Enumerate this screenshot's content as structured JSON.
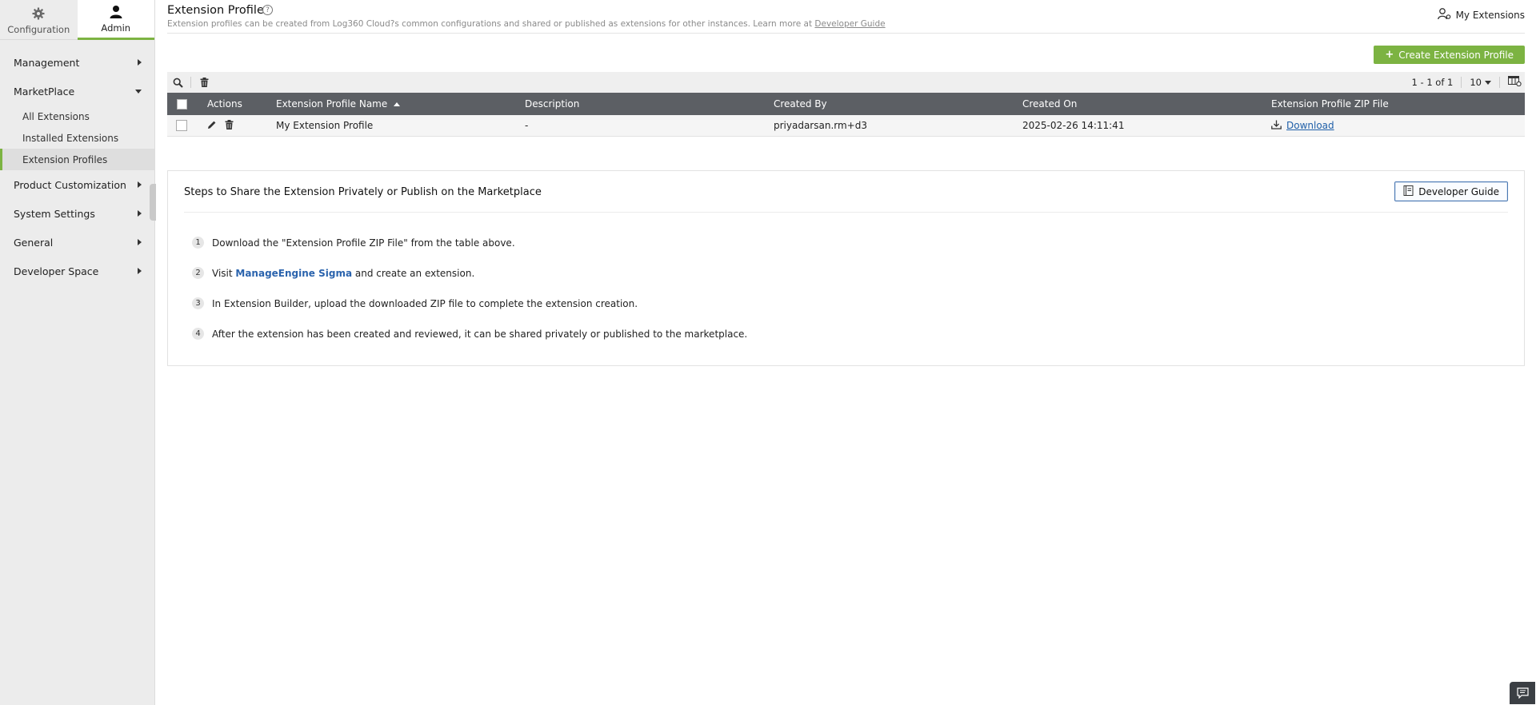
{
  "sidebar": {
    "tabs": [
      {
        "label": "Configuration",
        "icon": "gear-icon"
      },
      {
        "label": "Admin",
        "icon": "user-icon"
      }
    ],
    "items": [
      {
        "label": "Management"
      },
      {
        "label": "MarketPlace"
      },
      {
        "label": "Product Customization"
      },
      {
        "label": "System Settings"
      },
      {
        "label": "General"
      },
      {
        "label": "Developer Space"
      }
    ],
    "marketplace_sub": [
      {
        "label": "All Extensions"
      },
      {
        "label": "Installed Extensions"
      },
      {
        "label": "Extension Profiles"
      }
    ]
  },
  "header": {
    "title": "Extension Profile",
    "subtitle": "Extension profiles can be created from Log360 Cloud?s common configurations and shared or published as extensions for other instances. Learn more at ",
    "subtitle_link": "Developer Guide",
    "my_extensions": "My Extensions"
  },
  "toolbar": {
    "create_label": "Create Extension Profile",
    "pager_range": "1 - 1 of 1",
    "page_size": "10"
  },
  "table": {
    "columns": {
      "actions": "Actions",
      "name": "Extension Profile Name",
      "description": "Description",
      "created_by": "Created By",
      "created_on": "Created On",
      "zip": "Extension Profile ZIP File"
    },
    "rows": [
      {
        "name": "My Extension Profile",
        "description": "-",
        "created_by": "priyadarsan.rm+d3",
        "created_on": "2025-02-26 14:11:41",
        "zip_link": " Download"
      }
    ]
  },
  "steps": {
    "title": "Steps to Share the Extension Privately or Publish on the Marketplace",
    "guide_button": "Developer Guide",
    "items": [
      {
        "num": "1",
        "text": "Download the \"Extension Profile ZIP File\" from the table above."
      },
      {
        "num": "2",
        "pre": "Visit ",
        "link": "ManageEngine Sigma",
        "post": " and create an extension."
      },
      {
        "num": "3",
        "text": "In Extension Builder, upload the downloaded ZIP file to complete the extension creation."
      },
      {
        "num": "4",
        "text": "After the extension has been created and reviewed, it can be shared privately or published to the marketplace."
      }
    ]
  }
}
